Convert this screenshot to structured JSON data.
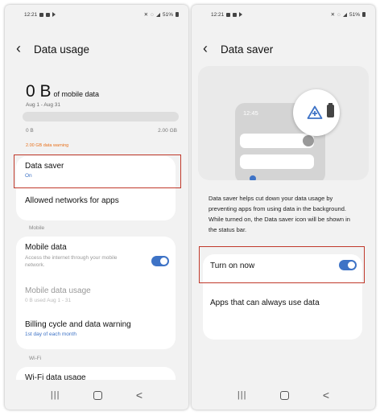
{
  "colors": {
    "accent": "#3e73c6",
    "highlight": "#c0392b",
    "background": "#f2f2f2"
  },
  "left": {
    "status": {
      "time": "12:21",
      "battery": "51%"
    },
    "title": "Data usage",
    "usage": {
      "amount": "0 B",
      "unit_label": "of mobile data",
      "period": "Aug 1 - Aug 31",
      "used_fraction": 0,
      "bar_min": "0 B",
      "bar_max": "2.00 GB",
      "warning": "2.00 GB data warning"
    },
    "data_saver": {
      "title": "Data saver",
      "status": "On"
    },
    "allowed_networks": "Allowed networks for apps",
    "mobile_section": "Mobile",
    "mobile_data": {
      "title": "Mobile data",
      "subtitle": "Access the internet through your mobile network.",
      "enabled": true
    },
    "mobile_data_usage": {
      "title": "Mobile data usage",
      "subtitle": "0 B used Aug 1 - 31"
    },
    "billing": {
      "title": "Billing cycle and data warning",
      "subtitle": "1st day of each month"
    },
    "wifi_section": "Wi-Fi",
    "wifi_usage": "Wi-Fi data usage",
    "nav": {
      "recents": "|||",
      "home": "",
      "back": "<"
    }
  },
  "right": {
    "status": {
      "time": "12:21",
      "battery": "51%"
    },
    "title": "Data saver",
    "illustration": {
      "time": "12:45",
      "icon": "data-saver-icon"
    },
    "description": "Data saver helps cut down your data usage by preventing apps from using data in the background. While turned on, the Data saver icon will be shown in the status bar.",
    "turn_on_now": {
      "label": "Turn on now",
      "enabled": true
    },
    "apps_always": "Apps that can always use data",
    "nav": {
      "recents": "|||",
      "home": "",
      "back": "<"
    }
  }
}
